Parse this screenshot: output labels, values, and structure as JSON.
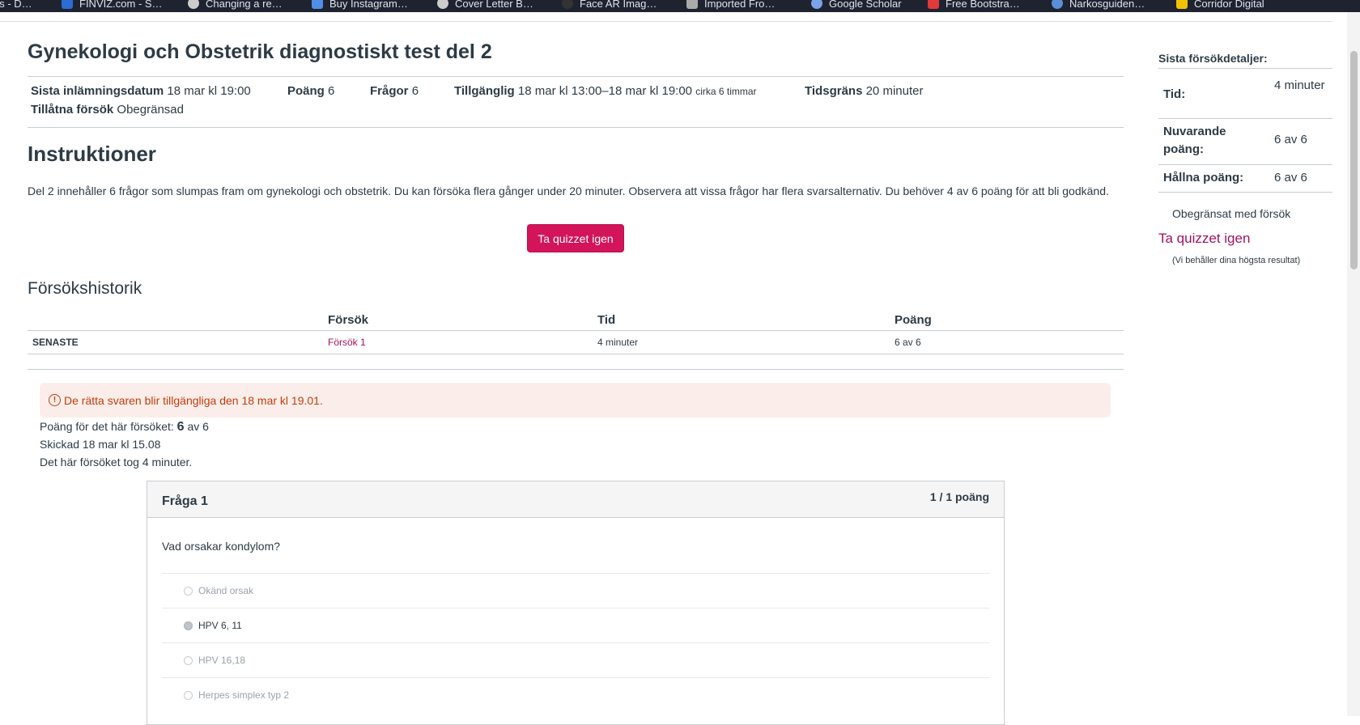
{
  "bookmarks": [
    {
      "label": "ns - D…",
      "color": "#1f2330"
    },
    {
      "label": "FINVIZ.com - S…",
      "color": "#2b6cd4"
    },
    {
      "label": "Changing a re…",
      "color": "#cccccc"
    },
    {
      "label": "Buy Instagram…",
      "color": "#4f8fe6"
    },
    {
      "label": "Cover Letter B…",
      "color": "#cccccc"
    },
    {
      "label": "Face AR Imag…",
      "color": "#333333"
    },
    {
      "label": "Imported Fro…",
      "color": "#aaaaaa"
    },
    {
      "label": "Google Scholar",
      "color": "#7aa3e8"
    },
    {
      "label": "Free Bootstra…",
      "color": "#e03a3a"
    },
    {
      "label": "Narkosguiden…",
      "color": "#5b8fd6"
    },
    {
      "label": "Corridor Digital",
      "color": "#f2c200"
    }
  ],
  "quiz": {
    "title": "Gynekologi och Obstetrik diagnostiskt test del 2",
    "due_label": "Sista inlämningsdatum",
    "due_value": "18 mar kl 19:00",
    "points_label": "Poäng",
    "points_value": "6",
    "questions_label": "Frågor",
    "questions_value": "6",
    "available_label": "Tillgänglig",
    "available_value": "18 mar kl 13:00–18 mar kl 19:00",
    "available_note": "cirka 6 timmar",
    "time_limit_label": "Tidsgräns",
    "time_limit_value": "20 minuter",
    "attempts_label": "Tillåtna försök",
    "attempts_value": "Obegränsad"
  },
  "instructions": {
    "heading": "Instruktioner",
    "text": "Del 2 innehåller 6 frågor som slumpas fram om gynekologi och obstetrik. Du kan försöka flera gånger under 20 minuter. Observera att vissa frågor har flera svarsalternativ. Du behöver 4 av 6 poäng för att bli godkänd.",
    "retake_button": "Ta quizzet igen"
  },
  "history": {
    "heading": "Försökshistorik",
    "columns": [
      "",
      "Försök",
      "Tid",
      "Poäng"
    ],
    "row": {
      "label": "SENASTE",
      "attempt": "Försök 1",
      "time": "4 minuter",
      "score": "6 av 6"
    }
  },
  "result": {
    "alert_icon": "!",
    "alert": "De rätta svaren blir tillgängliga den 18 mar kl 19.01.",
    "score_label": "Poäng för det här försöket:",
    "score_value": "6",
    "score_suffix": "av 6",
    "submitted": "Skickad 18 mar kl 15.08",
    "duration": "Det här försöket tog 4 minuter."
  },
  "question": {
    "title": "Fråga 1",
    "points": "1 / 1 poäng",
    "text": "Vad orsakar kondylom?",
    "answers": [
      "Okänd orsak",
      "HPV 6, 11",
      "HPV 16,18",
      "Herpes simplex typ 2"
    ],
    "selected_answer": "HPV 6, 11"
  },
  "sidebar": {
    "title": "Sista försökdetaljer:",
    "time_label": "Tid:",
    "time_value": "4 minuter",
    "current_label": "Nuvarande poäng:",
    "current_value": "6 av 6",
    "kept_label": "Hållna poäng:",
    "kept_value": "6 av 6",
    "unlimited": "Obegränsat med försök",
    "retake_link": "Ta quizzet igen",
    "note": "(Vi behåller dina högsta resultat)"
  }
}
